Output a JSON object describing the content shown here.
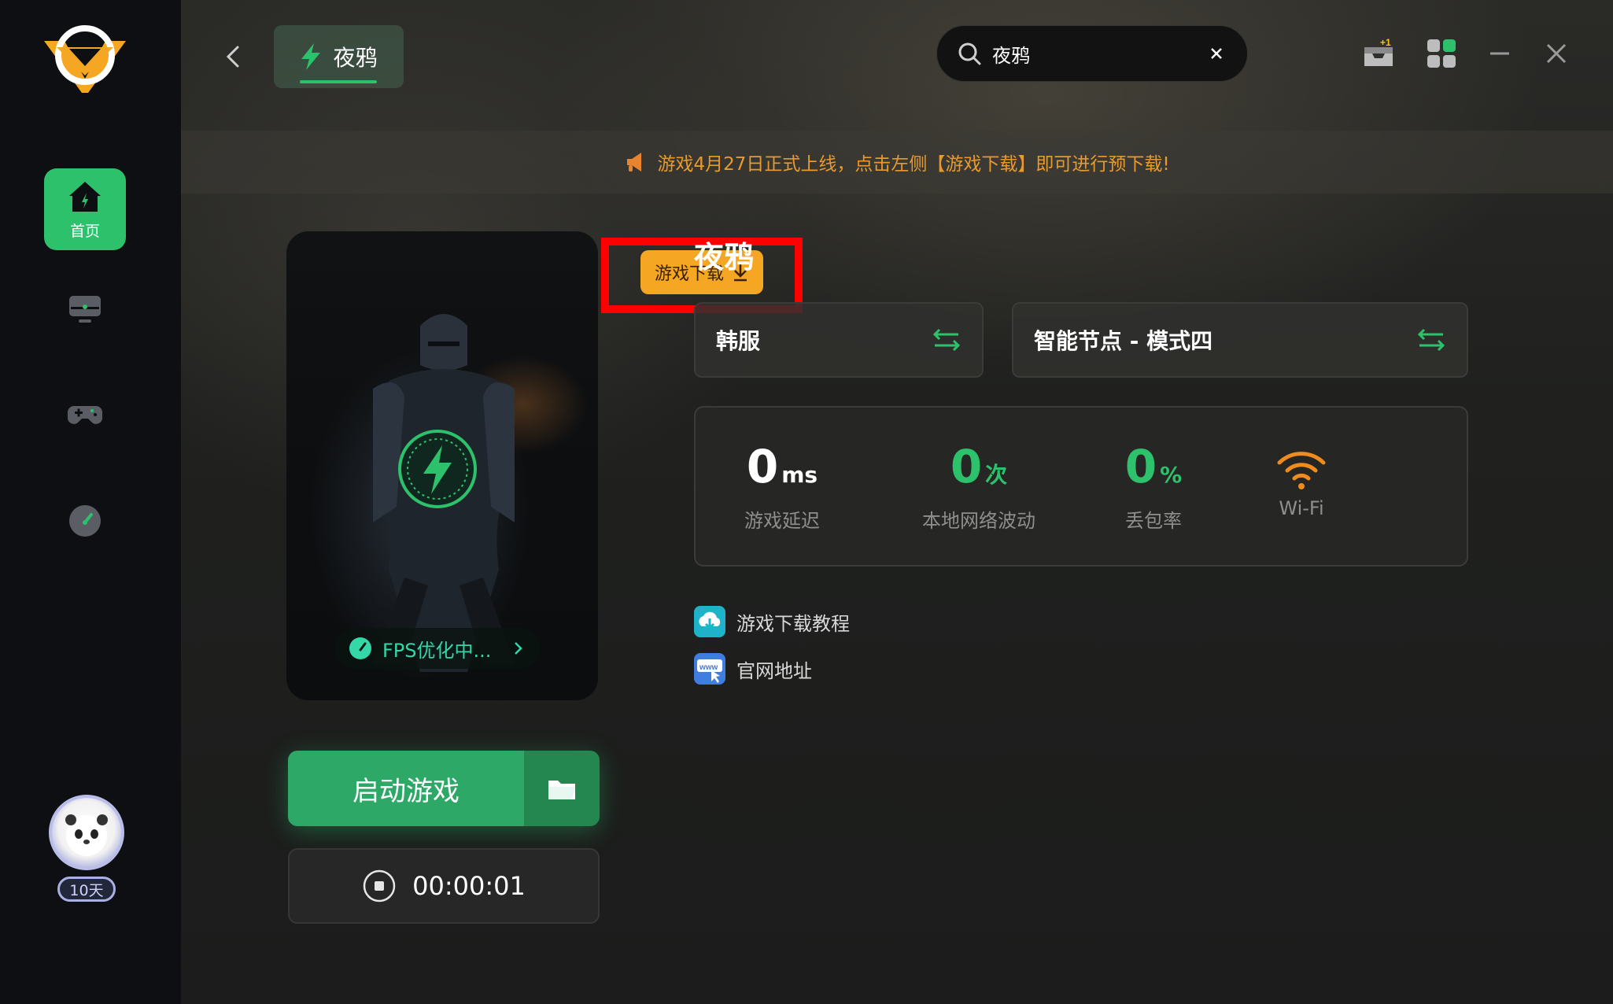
{
  "sidebar": {
    "items": [
      {
        "label": "首页",
        "icon": "home-icon",
        "active": true
      },
      {
        "label": "",
        "icon": "monitor-icon",
        "active": false
      },
      {
        "label": "",
        "icon": "gamepad-icon",
        "active": false
      },
      {
        "label": "",
        "icon": "speedometer-icon",
        "active": false
      }
    ],
    "user_badge": "10天"
  },
  "header": {
    "tab_label": "夜鸦",
    "search_value": "夜鸦"
  },
  "announcement": "游戏4月27日正式上线，点击左侧【游戏下载】即可进行预下载!",
  "card": {
    "download_label": "游戏下载",
    "fps_label": "FPS优化中..."
  },
  "actions": {
    "start_label": "启动游戏",
    "timer": "00:00:01"
  },
  "game": {
    "title": "夜鸦",
    "server": "韩服",
    "node": "智能节点 - 模式四"
  },
  "stats": {
    "latency": {
      "value": "0",
      "unit": "ms",
      "label": "游戏延迟"
    },
    "fluctuation": {
      "value": "0",
      "unit": "次",
      "label": "本地网络波动"
    },
    "packet_loss": {
      "value": "0",
      "unit": "%",
      "label": "丢包率"
    },
    "network": {
      "label": "Wi-Fi"
    }
  },
  "links": {
    "tutorial": "游戏下载教程",
    "website": "官网地址"
  },
  "colors": {
    "accent_green": "#2ec16c",
    "orange": "#f5a623",
    "announce_text": "#e89a2e",
    "stat_green": "#2ec16c"
  }
}
